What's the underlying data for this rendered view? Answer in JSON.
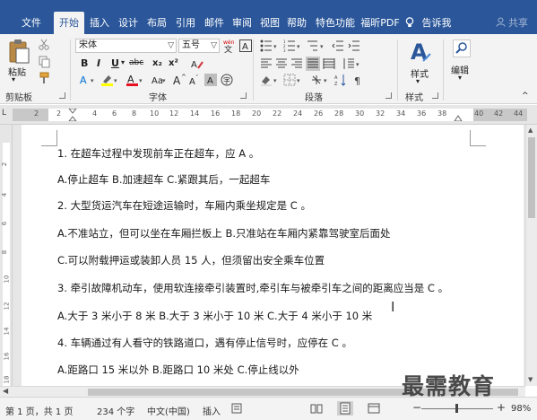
{
  "tabs": [
    {
      "label": "文件"
    },
    {
      "label": "开始"
    },
    {
      "label": "插入"
    },
    {
      "label": "设计"
    },
    {
      "label": "布局"
    },
    {
      "label": "引用"
    },
    {
      "label": "邮件"
    },
    {
      "label": "审阅"
    },
    {
      "label": "视图"
    },
    {
      "label": "帮助"
    },
    {
      "label": "特色功能"
    },
    {
      "label": "福昕PDF"
    }
  ],
  "active_tab": "开始",
  "tell_me": "告诉我",
  "share": "共享",
  "ribbon": {
    "clipboard": {
      "paste": "粘贴",
      "label": "剪贴板"
    },
    "font": {
      "name": "宋体",
      "size": "五号",
      "label": "字体",
      "bold": "B",
      "italic": "I",
      "underline": "U",
      "strike": "abc",
      "sub": "x₂",
      "sup": "x²"
    },
    "paragraph": {
      "label": "段落"
    },
    "styles": {
      "button": "样式",
      "label": "样式"
    },
    "editing": {
      "button": "编辑"
    }
  },
  "ruler": {
    "numbers": [
      "2",
      "2",
      "4",
      "6",
      "8",
      "10",
      "12",
      "14",
      "16",
      "18",
      "20",
      "22",
      "24",
      "26",
      "28",
      "30",
      "32",
      "34",
      "36",
      "38",
      "40",
      "42",
      "44"
    ]
  },
  "vruler": {
    "numbers": [
      "2",
      "4",
      "6",
      "8",
      "10",
      "12",
      "14",
      "16",
      "18"
    ]
  },
  "document": {
    "lines": [
      "1.   在超车过程中发现前车正在超车，应 A 。",
      "A.停止超车  B.加速超车  C.紧跟其后，一起超车",
      "2.   大型货运汽车在短途运输时，车厢内乘坐规定是 C 。",
      "A.不准站立，但可以坐在车厢拦板上  B.只准站在车厢内紧靠驾驶室后面处",
      "C.可以附载押运或装卸人员 15 人，但须留出安全乘车位置",
      "3.   牵引故障机动车，使用软连接牵引装置时,牵引车与被牵引车之间的距离应当是 C 。",
      "A.大于 3 米小于 8 米  B.大于 3 米小于 10 米  C.大于 4 米小于 10 米",
      "4.   车辆通过有人看守的铁路道口，遇有停止信号时，应停在 C 。",
      "A.距路口 15 米以外  B.距路口 10 米处  C.停止线以外"
    ]
  },
  "status": {
    "page": "第 1 页，共 1 页",
    "words": "234 个字",
    "lang": "中文(中国)",
    "mode": "插入",
    "zoom": "98%",
    "minus": "−",
    "plus": "+"
  },
  "watermark": "最需教育",
  "colors": {
    "accent": "#2b579a",
    "ribbon_bg": "#f3f3f3"
  }
}
